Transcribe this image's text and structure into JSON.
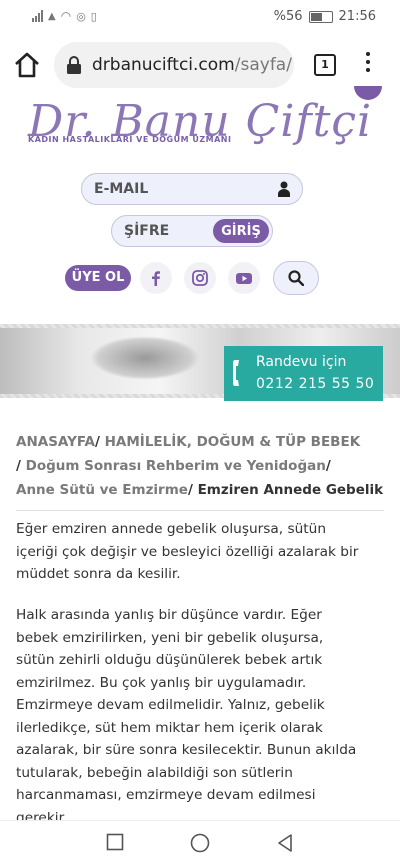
{
  "status": {
    "battery": "%56",
    "time": "21:56"
  },
  "browser": {
    "url_domain": "drbanuciftci.com",
    "url_path": "/sayfa/",
    "tab_count": "1"
  },
  "header": {
    "logo": "Dr. Banu Çiftçi",
    "logo_sub": "KADIN HASTALIKLARI VE DOĞUM UZMANI",
    "email_placeholder": "E-MAIL",
    "password_placeholder": "ŞİFRE",
    "login_label": "GİRİŞ",
    "register_label": "ÜYE OL"
  },
  "appointment": {
    "line1": "Randevu için",
    "line2": "0212 215 55 50"
  },
  "breadcrumb": {
    "items": [
      "ANASAYFA",
      "HAMİLELİK, DOĞUM & TÜP BEBEK",
      "Doğum Sonrası Rehberim ve Yenidoğan",
      "Anne Sütü ve Emzirme"
    ],
    "current": "Emziren Annede Gebelik"
  },
  "content": {
    "p1": "Eğer emziren annede gebelik oluşursa, sütün içeriği çok değişir ve besleyici özelliği azalarak bir müddet sonra da kesilir.",
    "p2": "Halk arasında yanlış bir düşünce vardır. Eğer bebek emzirilirken, yeni bir gebelik oluşursa, sütün zehirli olduğu düşünülerek bebek artık emzirilmez. Bu çok yanlış bir uygulamadır. Emzirmeye devam edilmelidir. Yalnız, gebelik ilerledikçe, süt hem miktar hem içerik olarak azalarak, bir süre sonra kesilecektir. Bunun akılda tutularak, bebeğin alabildiği son sütlerin harcanmaması, emzirmeye devam edilmesi gerekir."
  },
  "colors": {
    "brand_purple": "#7b5aa6",
    "accent_teal": "#29aaa0"
  }
}
